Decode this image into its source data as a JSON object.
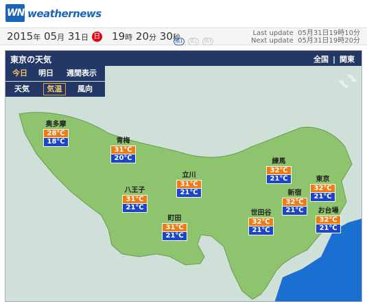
{
  "brand": {
    "logo_mark": "WN",
    "name": "weathernews"
  },
  "datebar": {
    "year": "2015",
    "year_unit": "年",
    "month": "05",
    "month_unit": "月",
    "day": "31",
    "day_unit": "日",
    "weekday": "日",
    "hour": "19",
    "hour_unit": "時",
    "minute": "20",
    "minute_unit": "分",
    "second": "30",
    "second_unit": "秒",
    "mini_icons": [
      "晴1",
      "晴2",
      "晴3"
    ],
    "last_update_label": "Last update",
    "last_update_time": "05月31日19時10分",
    "next_update_label": "Next update",
    "next_update_time": "05月31日19時20分"
  },
  "panel": {
    "title": "東京の天気",
    "links": [
      "全国",
      "|",
      "関東"
    ],
    "day_tabs": [
      "今日",
      "明日",
      "週間表示"
    ],
    "type_tabs": [
      "天気",
      "気温",
      "風向"
    ],
    "active_day_tab": "今日",
    "active_type_tab": "気温"
  },
  "stations": [
    {
      "name": "奥多摩",
      "high": "28℃",
      "low": "18℃"
    },
    {
      "name": "青梅",
      "high": "31℃",
      "low": "20℃"
    },
    {
      "name": "立川",
      "high": "31℃",
      "low": "21℃"
    },
    {
      "name": "練馬",
      "high": "32℃",
      "low": "21℃"
    },
    {
      "name": "東京",
      "high": "32℃",
      "low": "21℃"
    },
    {
      "name": "八王子",
      "high": "31℃",
      "low": "21℃"
    },
    {
      "name": "新宿",
      "high": "32℃",
      "low": "21℃"
    },
    {
      "name": "世田谷",
      "high": "32℃",
      "low": "21℃"
    },
    {
      "name": "町田",
      "high": "31℃",
      "low": "21℃"
    },
    {
      "name": "お台場",
      "high": "32℃",
      "low": "21℃"
    }
  ],
  "colors": {
    "brand_blue": "#1b63b8",
    "panel_header": "#243866",
    "land": "#8fc46e",
    "sea": "#1a6fd0",
    "background_land": "#cfe0d8",
    "high_temp": "#ef7c12",
    "low_temp": "#1b46c7",
    "sunday_red": "#e60012"
  },
  "icons": {
    "refresh": "refresh-icon",
    "weekday": "sunday-badge"
  }
}
